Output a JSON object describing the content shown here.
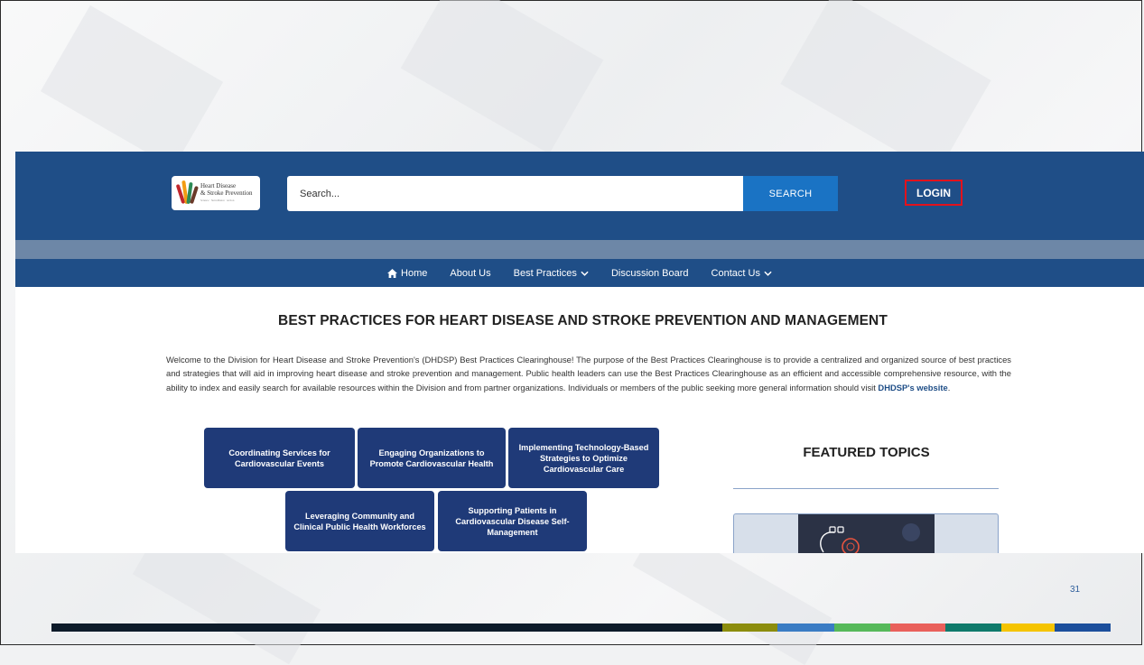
{
  "colors": {
    "header_bg": "#1f4e87",
    "nav_strip": "#6d87a7",
    "search_button_bg": "#1a73c4",
    "login_outline": "#e3121c",
    "topic_button_bg": "#1f3a78",
    "link": "#1f4e87",
    "bottom_bar": [
      "#0d1b2a",
      "#8c8d0d",
      "#3a7cc4",
      "#56b95a",
      "#e9605b",
      "#0f7a6b",
      "#f5c400",
      "#1c4f9c"
    ]
  },
  "header": {
    "logo_line1": "Heart Disease",
    "logo_line2": "& Stroke Prevention",
    "logo_tagline": "Science · Surveillance · Action",
    "search_placeholder": "Search...",
    "search_button": "SEARCH",
    "login_button": "LOGIN"
  },
  "nav": {
    "home": "Home",
    "about": "About Us",
    "best_practices": "Best Practices",
    "discussion": "Discussion Board",
    "contact": "Contact Us"
  },
  "main": {
    "heading": "BEST PRACTICES FOR HEART DISEASE AND STROKE PREVENTION AND MANAGEMENT",
    "intro_text": "Welcome to the Division for Heart Disease and Stroke Prevention's (DHDSP) Best Practices Clearinghouse! The purpose of the Best Practices Clearinghouse is to provide a centralized and organized source of best practices and strategies that will aid in improving heart disease and stroke prevention and management. Public health leaders can use the Best Practices Clearinghouse as an efficient and accessible comprehensive resource, with the ability to index and easily search for available resources within the Division and from partner organizations. Individuals or members of the public seeking more general information should visit ",
    "intro_link": "DHDSP's website",
    "intro_end": ".",
    "topics": [
      "Coordinating Services for Cardiovascular Events",
      "Engaging Organizations to Promote Cardiovascular Health",
      "Implementing Technology-Based Strategies to Optimize Cardiovascular Care",
      "Leveraging Community and Clinical Public Health Workforces",
      "Supporting Patients in Cardiovascular Disease Self-Management"
    ],
    "featured_title": "FEATURED TOPICS"
  },
  "slide": {
    "page_number": "31"
  }
}
